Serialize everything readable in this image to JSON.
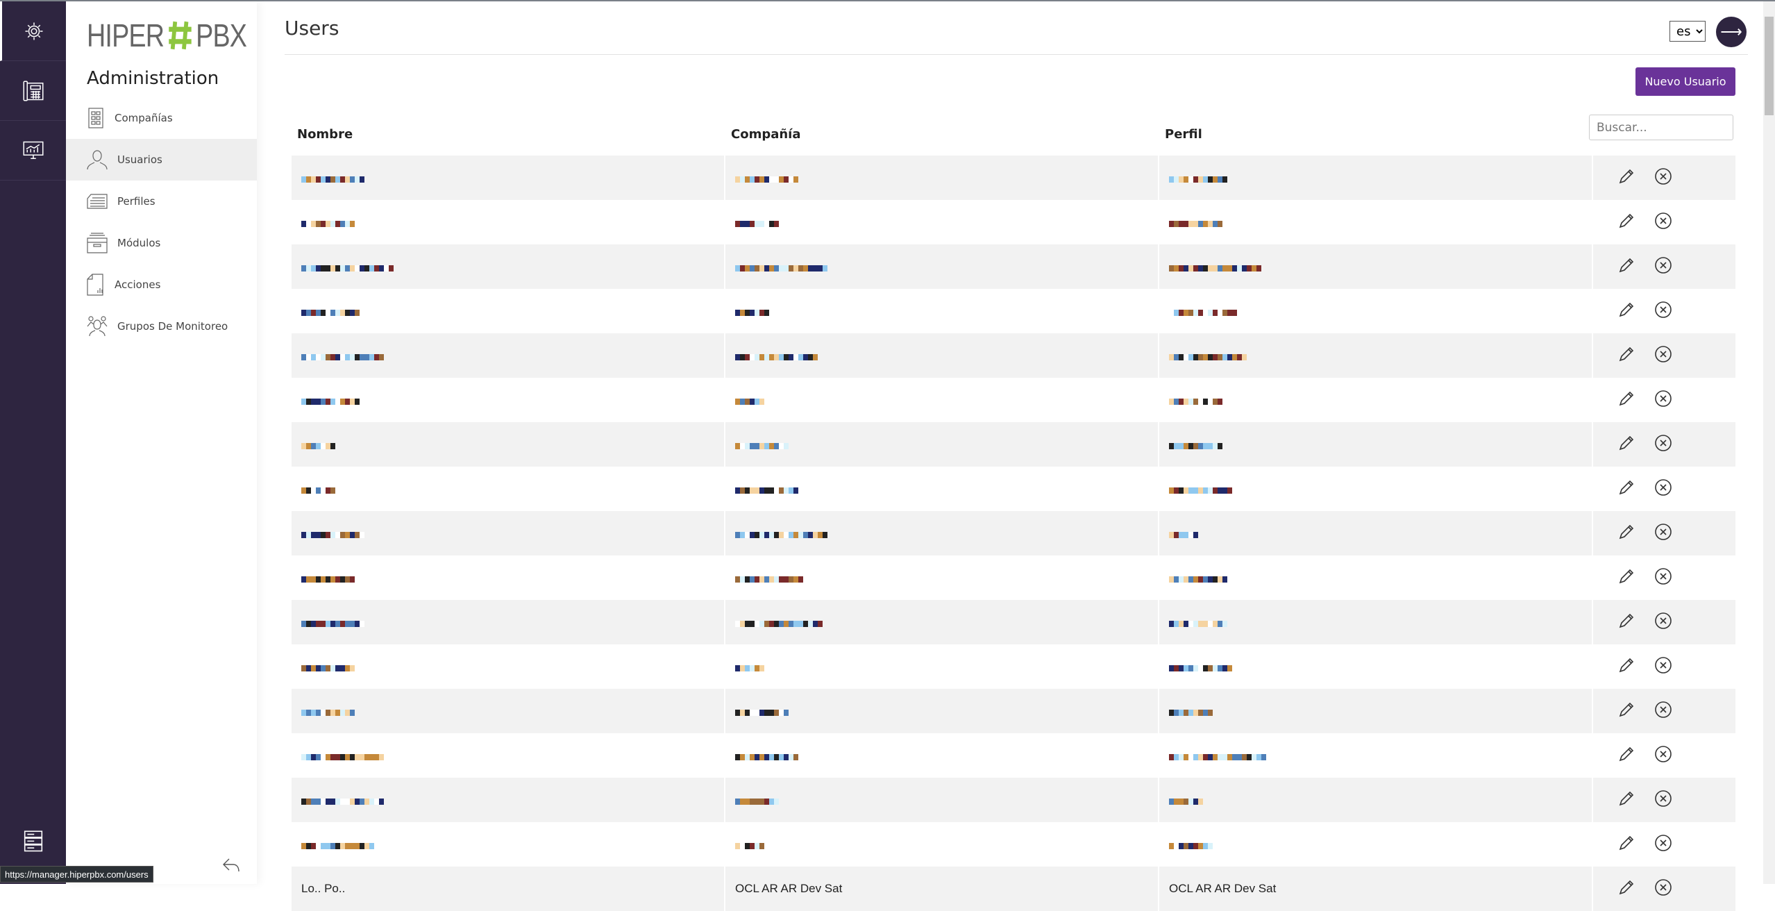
{
  "app": {
    "logo_left": "HIPER",
    "logo_right": "PBX",
    "brand_color": "#8dc63f",
    "accent": "#6a3399",
    "rail_color": "#2e2540"
  },
  "rail": {
    "items": [
      {
        "icon": "gear-icon"
      },
      {
        "icon": "phone-icon"
      },
      {
        "icon": "monitor-chart-icon"
      }
    ],
    "bottom_icon": "server-icon"
  },
  "sidebar": {
    "section": "Administration",
    "items": [
      {
        "label": "Compañías",
        "icon": "building-icon"
      },
      {
        "label": "Usuarios",
        "icon": "user-icon",
        "active": true
      },
      {
        "label": "Perfiles",
        "icon": "list-icon"
      },
      {
        "label": "Módulos",
        "icon": "archive-icon"
      },
      {
        "label": "Acciones",
        "icon": "document-chart-icon"
      },
      {
        "label": "Grupos De Monitoreo",
        "icon": "group-icon"
      }
    ]
  },
  "header": {
    "title": "Users",
    "language": "es"
  },
  "toolbar": {
    "new_user": "Nuevo Usuario",
    "search_placeholder": "Buscar..."
  },
  "table": {
    "columns": [
      "Nombre",
      "Compañía",
      "Perfil"
    ],
    "rows_redacted": 16,
    "last_row": {
      "name": "Lo.. Po..",
      "company": "OCL AR AR Dev Sat",
      "profile": "OCL AR AR Dev Sat"
    }
  },
  "status_bar": {
    "url": "https://manager.hiperpbx.com/users"
  }
}
